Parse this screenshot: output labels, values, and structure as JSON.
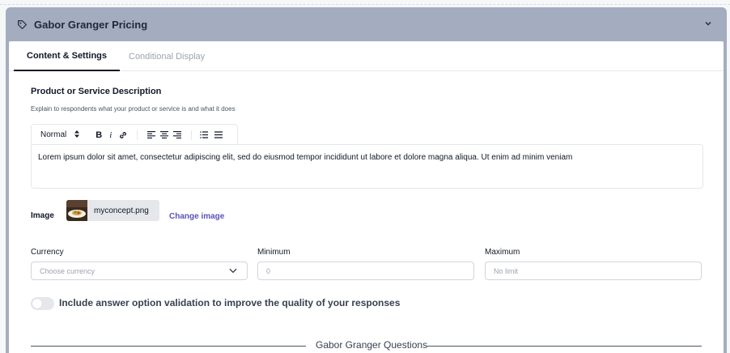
{
  "card": {
    "title": "Gabor Granger Pricing"
  },
  "tabs": [
    {
      "label": "Content & Settings"
    },
    {
      "label": "Conditional Display"
    }
  ],
  "description": {
    "title": "Product or Service Description",
    "hint": "Explain to respondents what your product or service is and what it does",
    "toolbar": {
      "format": "Normal",
      "bold": "B",
      "italic": "i"
    },
    "text": "Lorem ipsum dolor sit amet, consectetur adipiscing elit, sed do eiusmod tempor incididunt ut labore et dolore magna aliqua. Ut enim ad minim veniam"
  },
  "image": {
    "label": "Image",
    "filename": "myconcept.png",
    "change": "Change image"
  },
  "currency": {
    "label": "Currency",
    "placeholder": "Choose currency"
  },
  "minimum": {
    "label": "Minimum",
    "placeholder": "0"
  },
  "maximum": {
    "label": "Maximum",
    "placeholder": "No limit"
  },
  "validation": {
    "label": "Include answer option validation to improve the quality of your responses",
    "enabled": false
  },
  "divider": {
    "label": "Gabor Granger Questions"
  },
  "colors": {
    "header": "#a3adbf",
    "link": "#5b52b6"
  }
}
